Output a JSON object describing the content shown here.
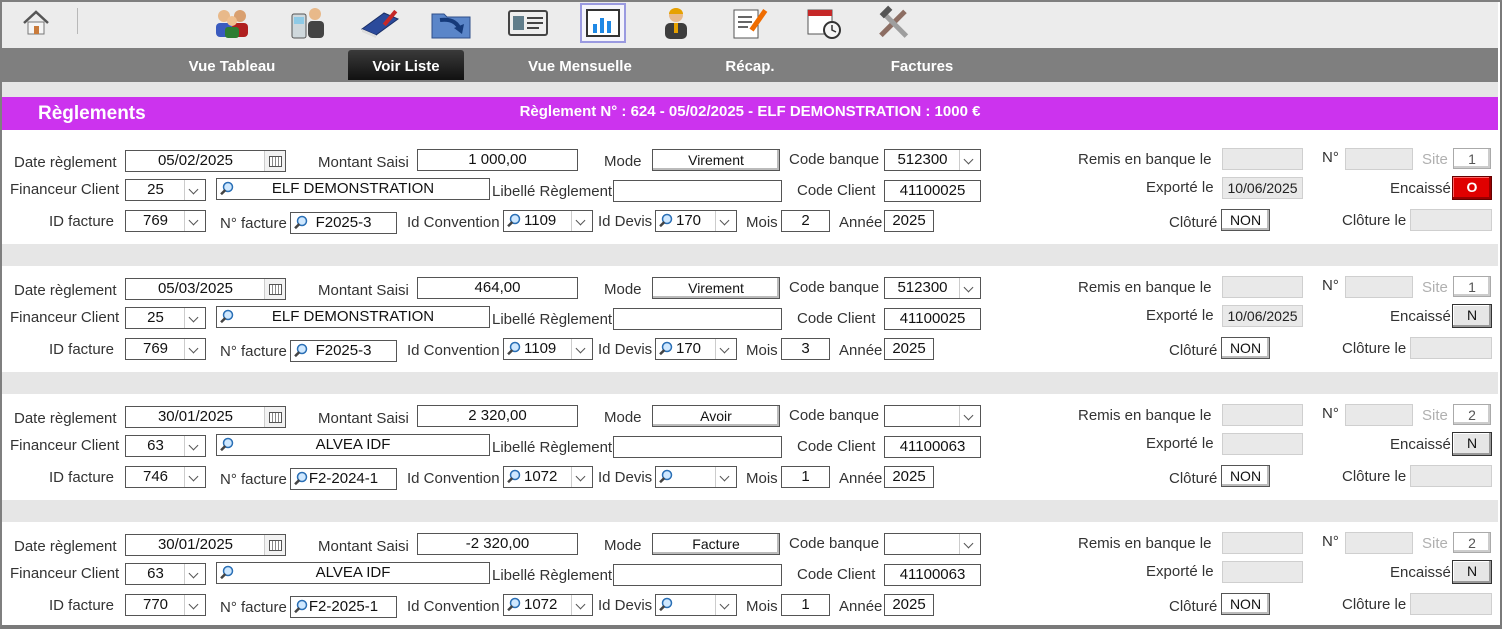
{
  "toolbar": {
    "icons": [
      {
        "name": "home-icon"
      },
      {
        "name": "users-icon"
      },
      {
        "name": "phone-contact-icon"
      },
      {
        "name": "book-icon"
      },
      {
        "name": "import-folder-icon"
      },
      {
        "name": "id-card-icon"
      },
      {
        "name": "chart-icon"
      },
      {
        "name": "person-icon"
      },
      {
        "name": "edit-document-icon"
      },
      {
        "name": "calendar-clock-icon"
      },
      {
        "name": "tools-icon"
      }
    ]
  },
  "nav": {
    "tabs": [
      "Vue Tableau",
      "Voir Liste",
      "Vue Mensuelle",
      "Récap.",
      "Factures"
    ],
    "active": "Voir Liste"
  },
  "header": {
    "title": "Règlements",
    "summary": "Règlement  N° : 624 - 05/02/2025 - ELF DEMONSTRATION : 1000 €"
  },
  "labels": {
    "date_reglement": "Date règlement",
    "montant_saisi": "Montant Saisi",
    "mode": "Mode",
    "code_banque": "Code banque",
    "remis_en_banque": "Remis en banque le",
    "numero": "N°",
    "site": "Site",
    "financeur_client": "Financeur Client",
    "libelle_reglement": "Libellé Règlement",
    "code_client": "Code Client",
    "exporte_le": "Exporté le",
    "encaisse": "Encaissé",
    "id_facture": "ID facture",
    "no_facture": "N° facture",
    "id_convention": "Id Convention",
    "id_devis": "Id Devis",
    "mois": "Mois",
    "annee": "Année",
    "cloture": "Clôturé",
    "cloture_le": "Clôture le"
  },
  "records": [
    {
      "date": "05/02/2025",
      "montant": "1 000,00",
      "mode": "Virement",
      "code_banque": "512300",
      "remis": "",
      "numero": "",
      "site": "1",
      "financeur": "25",
      "client_name": "ELF DEMONSTRATION",
      "libelle": "",
      "code_client": "41100025",
      "exporte": "10/06/2025",
      "encaisse": "O",
      "id_facture": "769",
      "no_facture": "F2025-3",
      "id_convention": "1109",
      "id_devis": "170",
      "mois": "2",
      "annee": "2025",
      "cloture": "NON",
      "cloture_le": ""
    },
    {
      "date": "05/03/2025",
      "montant": "464,00",
      "mode": "Virement",
      "code_banque": "512300",
      "remis": "",
      "numero": "",
      "site": "1",
      "financeur": "25",
      "client_name": "ELF DEMONSTRATION",
      "libelle": "",
      "code_client": "41100025",
      "exporte": "10/06/2025",
      "encaisse": "N",
      "id_facture": "769",
      "no_facture": "F2025-3",
      "id_convention": "1109",
      "id_devis": "170",
      "mois": "3",
      "annee": "2025",
      "cloture": "NON",
      "cloture_le": ""
    },
    {
      "date": "30/01/2025",
      "montant": "2 320,00",
      "mode": "Avoir",
      "code_banque": "",
      "remis": "",
      "numero": "",
      "site": "2",
      "financeur": "63",
      "client_name": "ALVEA IDF",
      "libelle": "",
      "code_client": "41100063",
      "exporte": "",
      "encaisse": "N",
      "id_facture": "746",
      "no_facture": "F2-2024-1",
      "id_convention": "1072",
      "id_devis": "",
      "mois": "1",
      "annee": "2025",
      "cloture": "NON",
      "cloture_le": ""
    },
    {
      "date": "30/01/2025",
      "montant": "-2 320,00",
      "mode": "Facture",
      "code_banque": "",
      "remis": "",
      "numero": "",
      "site": "2",
      "financeur": "63",
      "client_name": "ALVEA IDF",
      "libelle": "",
      "code_client": "41100063",
      "exporte": "",
      "encaisse": "N",
      "id_facture": "770",
      "no_facture": "F2-2025-1",
      "id_convention": "1072",
      "id_devis": "",
      "mois": "1",
      "annee": "2025",
      "cloture": "NON",
      "cloture_le": ""
    }
  ],
  "colors": {
    "accent": "#cc33ee",
    "nav": "#7f7f7f",
    "encaisse_yes": "#e00000"
  }
}
